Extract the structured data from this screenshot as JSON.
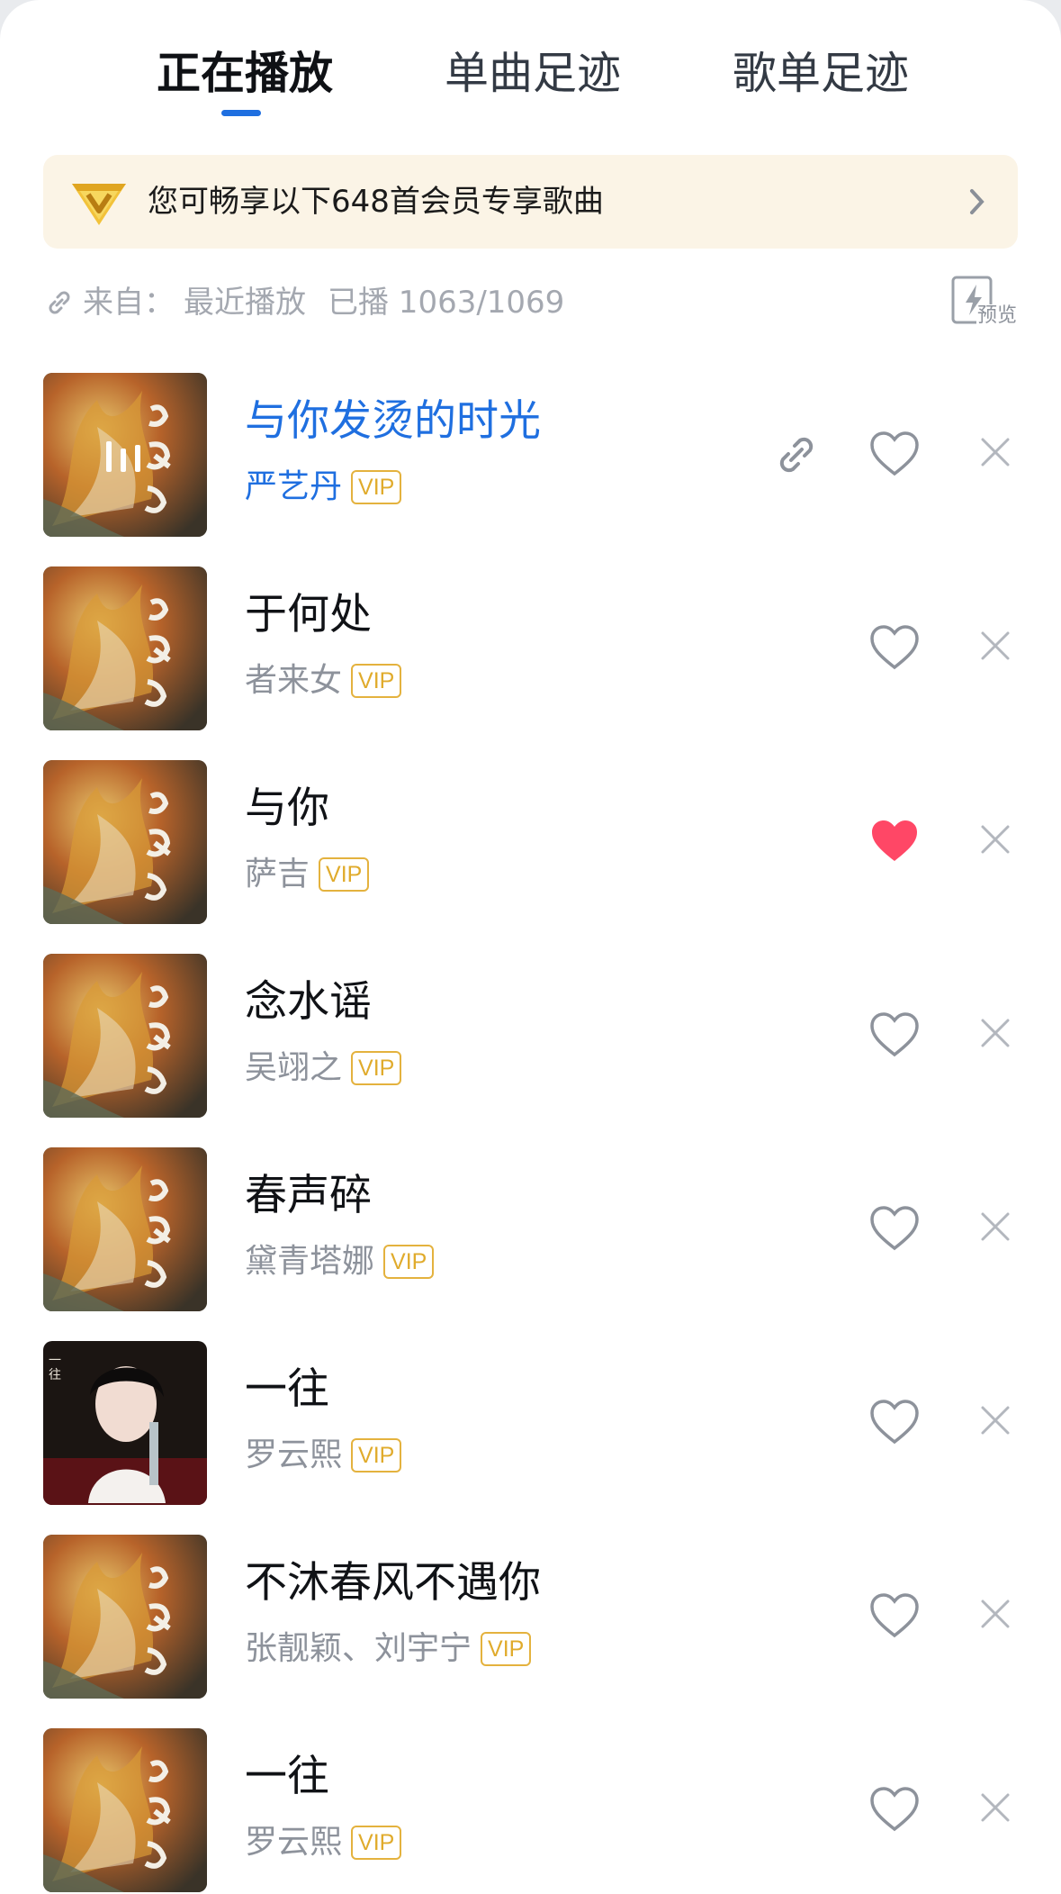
{
  "tabs": [
    {
      "label": "正在播放",
      "active": true
    },
    {
      "label": "单曲足迹",
      "active": false
    },
    {
      "label": "歌单足迹",
      "active": false
    }
  ],
  "vip_banner": {
    "text": "您可畅享以下648首会员专享歌曲",
    "logo_icon": "vip-diamond-icon",
    "chevron_icon": "chevron-right-icon"
  },
  "source": {
    "label": "来自：",
    "name": "最近播放",
    "played": "已播 1063/1069",
    "preview_label": "预览"
  },
  "colors": {
    "accent": "#1f6fe0",
    "liked": "#ff4766",
    "vip": "#e4b23e"
  },
  "songs": [
    {
      "title": "与你发烫的时光",
      "artist": "严艺丹",
      "badge": "VIP",
      "playing": true,
      "liked": false,
      "cover": "fire-dragon"
    },
    {
      "title": "于何处",
      "artist": "者来女",
      "badge": "VIP",
      "playing": false,
      "liked": false,
      "cover": "fire-dragon"
    },
    {
      "title": "与你",
      "artist": "萨吉",
      "badge": "VIP",
      "playing": false,
      "liked": true,
      "cover": "fire-dragon"
    },
    {
      "title": "念水谣",
      "artist": "吴翊之",
      "badge": "VIP",
      "playing": false,
      "liked": false,
      "cover": "fire-dragon"
    },
    {
      "title": "春声碎",
      "artist": "黛青塔娜",
      "badge": "VIP",
      "playing": false,
      "liked": false,
      "cover": "fire-dragon"
    },
    {
      "title": "一往",
      "artist": "罗云熙",
      "badge": "VIP",
      "playing": false,
      "liked": false,
      "cover": "portrait",
      "cover_text": "一往"
    },
    {
      "title": "不沐春风不遇你",
      "artist": "张靓颖、刘宇宁",
      "badge": "VIP",
      "playing": false,
      "liked": false,
      "cover": "fire-dragon"
    },
    {
      "title": "一往",
      "artist": "罗云熙",
      "badge": "VIP",
      "playing": false,
      "liked": false,
      "cover": "fire-dragon"
    }
  ]
}
